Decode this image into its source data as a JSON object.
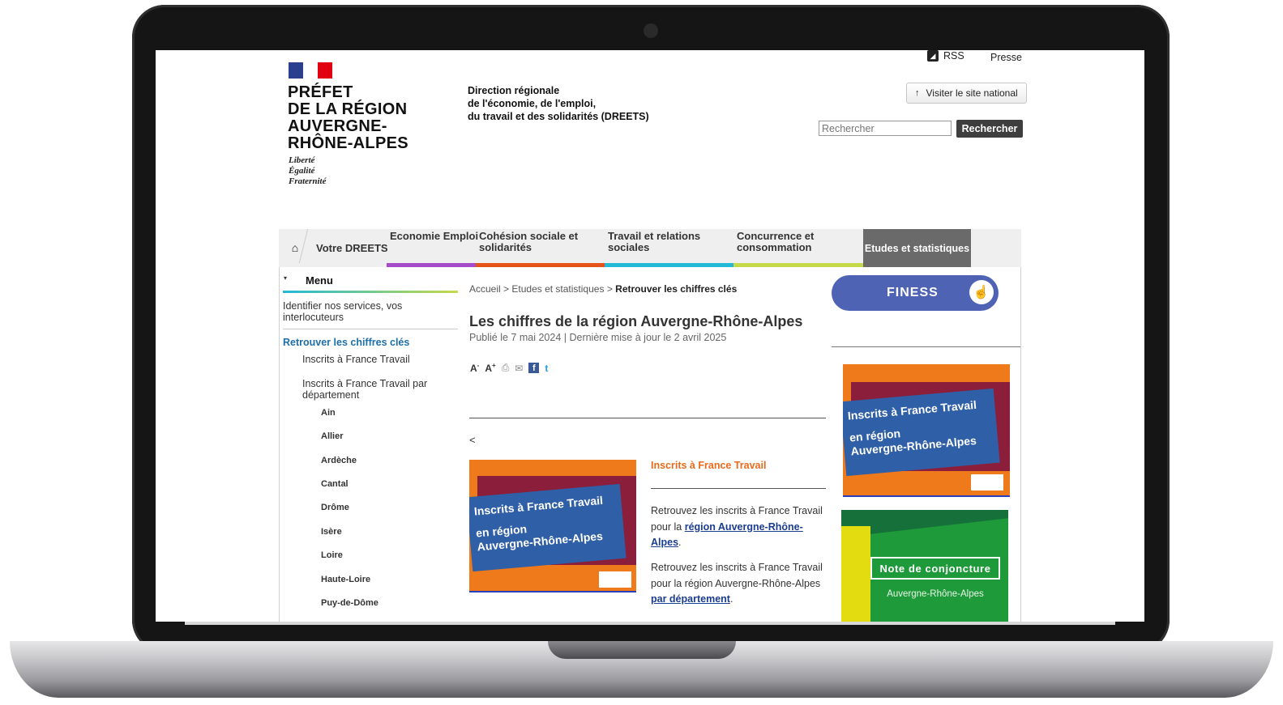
{
  "header": {
    "flag_colors": [
      "#2b3f8f",
      "#ffffff",
      "#e1000f"
    ],
    "prefet_lines": [
      "PRÉFET",
      "DE LA RÉGION",
      "AUVERGNE-",
      "RHÔNE-ALPES"
    ],
    "motto_lines": [
      "Liberté",
      "Égalité",
      "Fraternité"
    ],
    "dreets_lines": [
      "Direction régionale",
      "de l'économie, de l'emploi,",
      "du travail et des solidarités (DREETS)"
    ],
    "rss_label": "RSS",
    "presse_label": "Presse",
    "visit_label": "Visiter le site national",
    "visit_icon": "↑",
    "search_placeholder": "Rechercher",
    "search_button": "Rechercher"
  },
  "nav": {
    "home_icon": "⌂",
    "items": [
      {
        "label": "Votre DREETS"
      },
      {
        "label": "Economie Emploi",
        "color": "#a64ac9"
      },
      {
        "label": "Cohésion sociale et solidarités",
        "color": "#e5531b"
      },
      {
        "label": "Travail et relations sociales",
        "color": "#22b8d6"
      },
      {
        "label": "Concurrence et consommation",
        "color": "#c6d94a"
      },
      {
        "label": "Etudes et statistiques"
      }
    ]
  },
  "sidebar": {
    "menu_label": "Menu",
    "link1": "Identifier nos services, vos interlocuteurs",
    "active": "Retrouver les chiffres clés",
    "sub1": "Inscrits à France Travail",
    "sub2": "Inscrits à France Travail par département",
    "departments": [
      "Ain",
      "Allier",
      "Ardèche",
      "Cantal",
      "Drôme",
      "Isère",
      "Loire",
      "Haute-Loire",
      "Puy-de-Dôme"
    ]
  },
  "main": {
    "breadcrumb_home": "Accueil",
    "breadcrumb_sep": ">",
    "breadcrumb_section": "Etudes et statistiques",
    "breadcrumb_current": "Retrouver les chiffres clés",
    "title": "Les chiffres de la région Auvergne-Rhône-Alpes",
    "published": "Publié le 7 mai 2024 | Dernière mise à jour le 2 avril 2025",
    "font_minus": "A",
    "font_plus": "A",
    "back_arrow": "<",
    "section_title": "Inscrits à France Travail",
    "para1_before": "Retrouvez les inscrits à France Travail pour la ",
    "para1_link": "région Auvergne-Rhône-Alpes",
    "para1_after": ".",
    "para2_before": "Retrouvez les inscrits à France Travail pour la région Auvergne-Rhône-Alpes ",
    "para2_link": "par département",
    "para2_after": "."
  },
  "cards": {
    "image_line1": "Inscrits à France Travail",
    "image_line2": "en région",
    "image_line3": "Auvergne-Rhône-Alpes",
    "finess_label": "FINESS",
    "note_title": "Note de conjoncture",
    "note_sub": "Auvergne-Rhône-Alpes"
  }
}
